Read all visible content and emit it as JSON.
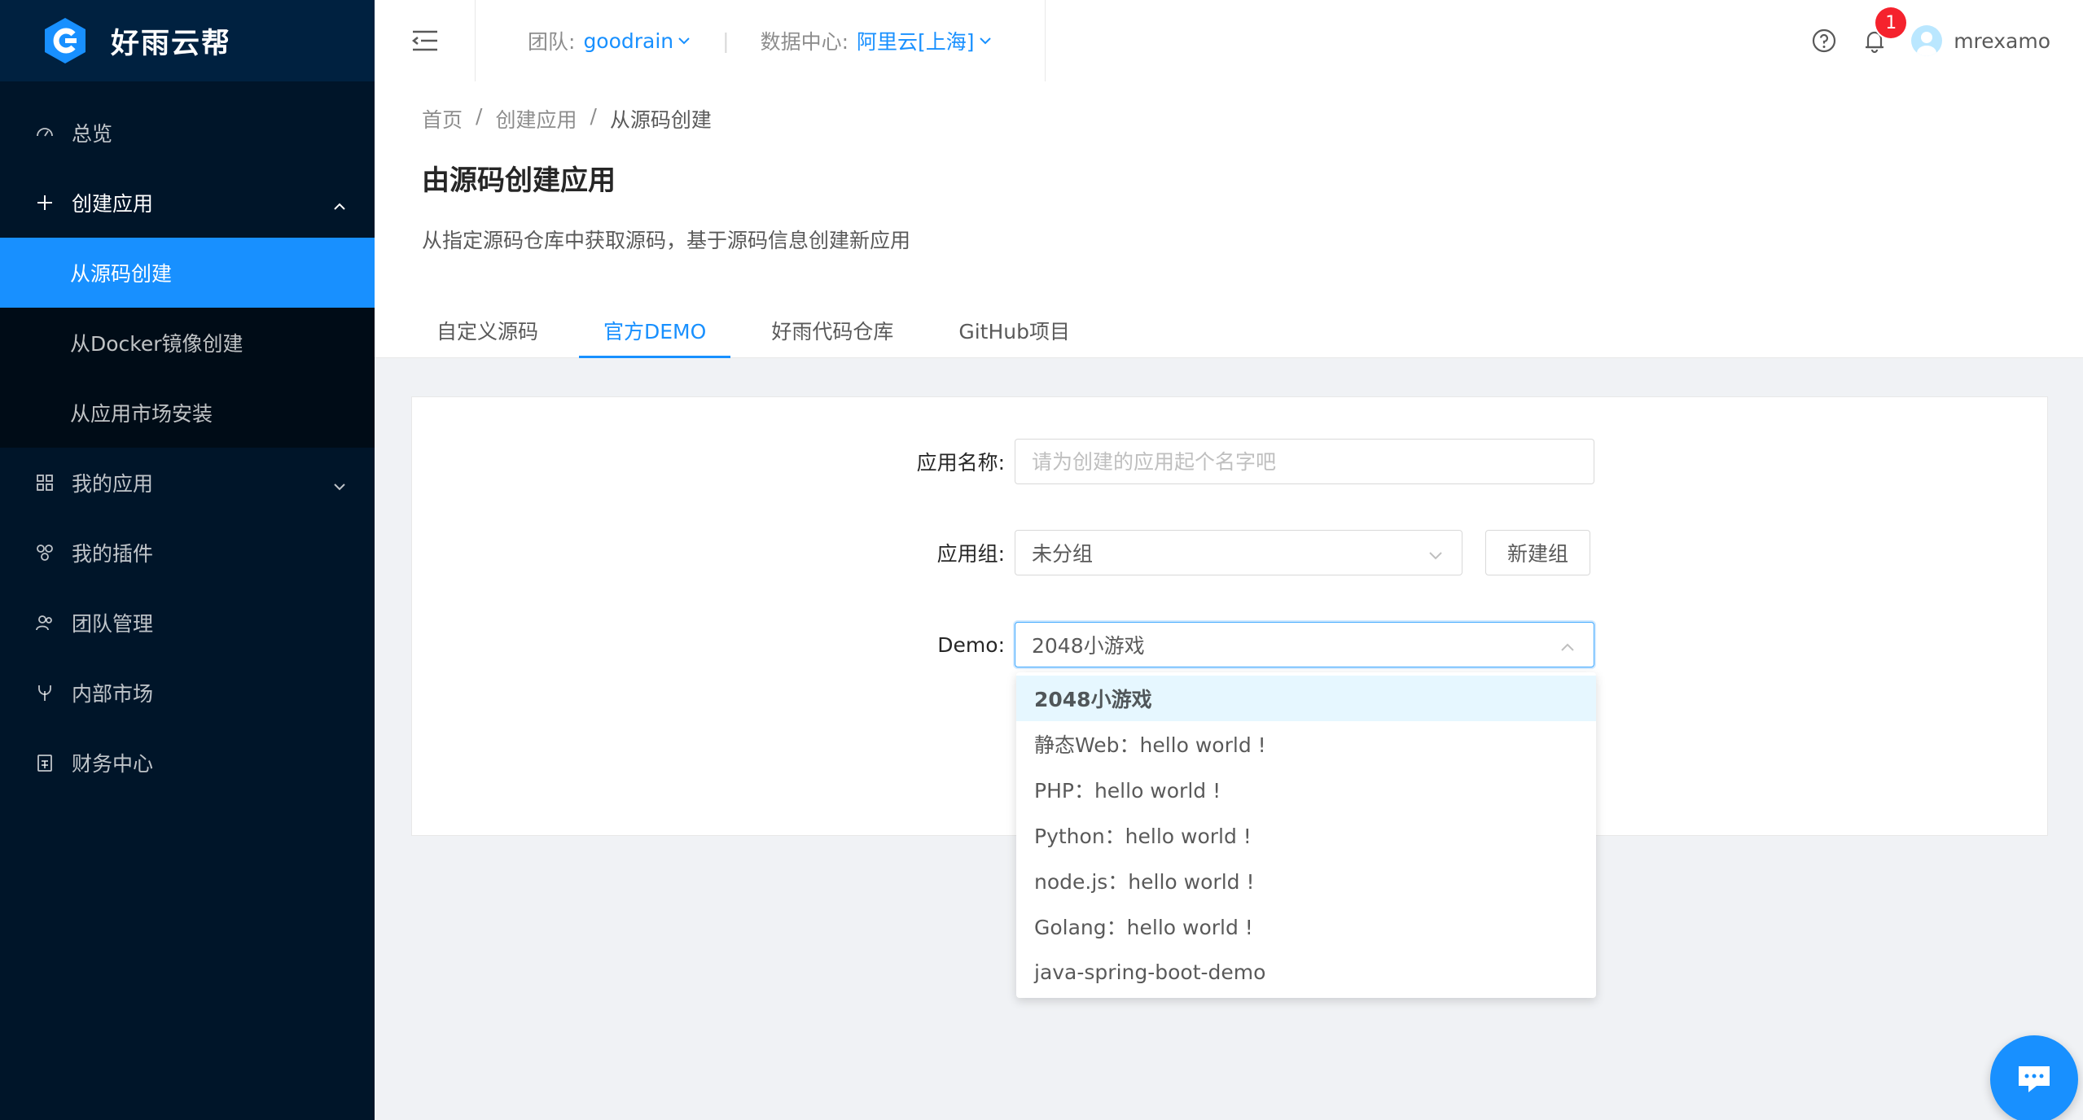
{
  "app": {
    "name": "好雨云帮"
  },
  "sidebar": {
    "items": [
      {
        "label": "总览",
        "icon": "dashboard-icon"
      },
      {
        "label": "创建应用",
        "icon": "plus-icon",
        "open": true,
        "children": [
          {
            "label": "从源码创建",
            "active": true
          },
          {
            "label": "从Docker镜像创建"
          },
          {
            "label": "从应用市场安装"
          }
        ]
      },
      {
        "label": "我的应用",
        "icon": "appstore-icon"
      },
      {
        "label": "我的插件",
        "icon": "api-icon"
      },
      {
        "label": "团队管理",
        "icon": "team-icon"
      },
      {
        "label": "内部市场",
        "icon": "fork-icon"
      },
      {
        "label": "财务中心",
        "icon": "account-book-icon"
      }
    ]
  },
  "header": {
    "team_label": "团队:",
    "team_value": "goodrain",
    "dc_label": "数据中心:",
    "dc_value": "阿里云[上海]",
    "notification_count": "1",
    "username": "mrexamo"
  },
  "breadcrumb": [
    "首页",
    "创建应用",
    "从源码创建"
  ],
  "page": {
    "title": "由源码创建应用",
    "description": "从指定源码仓库中获取源码，基于源码信息创建新应用"
  },
  "tabs": [
    {
      "label": "自定义源码"
    },
    {
      "label": "官方DEMO",
      "active": true
    },
    {
      "label": "好雨代码仓库"
    },
    {
      "label": "GitHub项目"
    }
  ],
  "form": {
    "name_label": "应用名称:",
    "name_placeholder": "请为创建的应用起个名字吧",
    "group_label": "应用组:",
    "group_value": "未分组",
    "new_group_button": "新建组",
    "demo_label": "Demo:",
    "demo_value": "2048小游戏"
  },
  "demo_options": [
    "2048小游戏",
    "静态Web：hello world !",
    "PHP：hello world !",
    "Python：hello world !",
    "node.js：hello world !",
    "Golang：hello world !",
    "java-spring-boot-demo"
  ],
  "colors": {
    "primary": "#1890ff",
    "sidebar": "#001529",
    "badge": "#f5222d"
  }
}
